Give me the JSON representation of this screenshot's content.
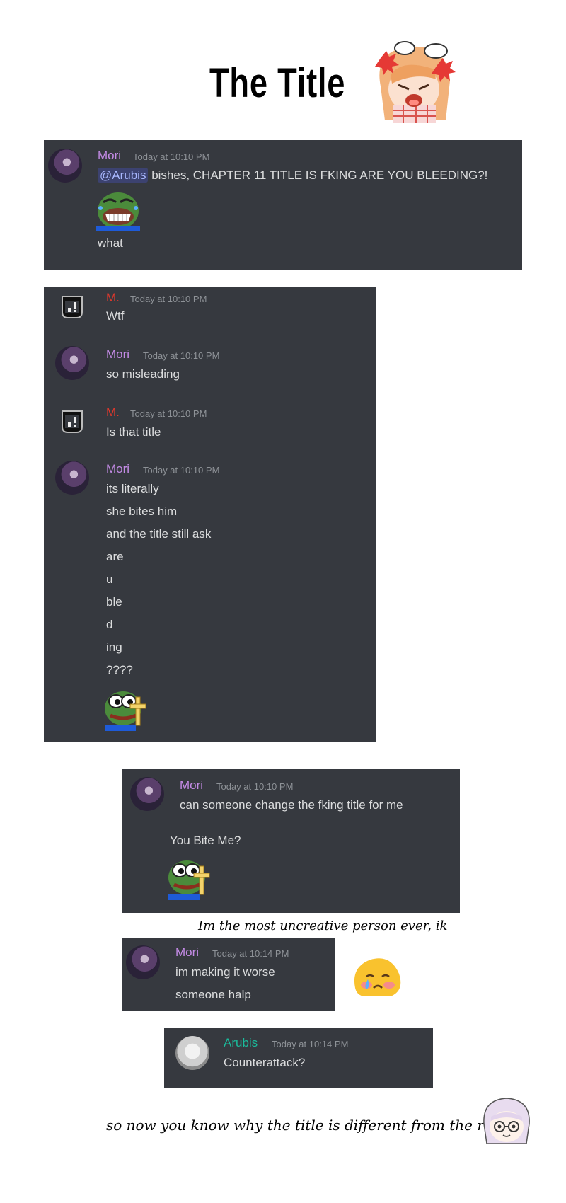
{
  "title": "The Title",
  "panel1": {
    "name": "Mori",
    "time": "Today at 10:10 PM",
    "mention": "@Arubis",
    "text": "bishes, CHAPTER 11 TITLE IS FKING ARE YOU BLEEDING?!",
    "text2": "what"
  },
  "panel2": {
    "messages": [
      {
        "name": "M.",
        "time": "Today at 10:10 PM",
        "lines": [
          "Wtf"
        ]
      },
      {
        "name": "Mori",
        "time": "Today at 10:10 PM",
        "lines": [
          "so misleading"
        ]
      },
      {
        "name": "M.",
        "time": "Today at 10:10 PM",
        "lines": [
          "Is that title"
        ]
      },
      {
        "name": "Mori",
        "time": "Today at 10:10 PM",
        "lines": [
          "its literally",
          "she bites him",
          "and the title still ask",
          "are",
          "u",
          "ble",
          "d",
          "ing",
          "????"
        ]
      }
    ]
  },
  "panel3": {
    "name": "Mori",
    "time": "Today at 10:10 PM",
    "text": "can someone change the fking title for me",
    "text2": "You Bite Me?"
  },
  "caption1": "Im the most uncreative person ever, ik",
  "panel4": {
    "name": "Mori",
    "time": "Today at 10:14 PM",
    "lines": [
      "im making it worse",
      "someone halp"
    ]
  },
  "panel5": {
    "name": "Arubis",
    "time": "Today at 10:14 PM",
    "text": "Counterattack?"
  },
  "caption2": "so now you know why the title is different from the raw",
  "colors": {
    "panel_bg": "#36393f",
    "mori": "#c48be6",
    "m": "#e0382c",
    "arubis": "#1abc9c",
    "timestamp": "#8e9297",
    "text": "#dcddde"
  }
}
